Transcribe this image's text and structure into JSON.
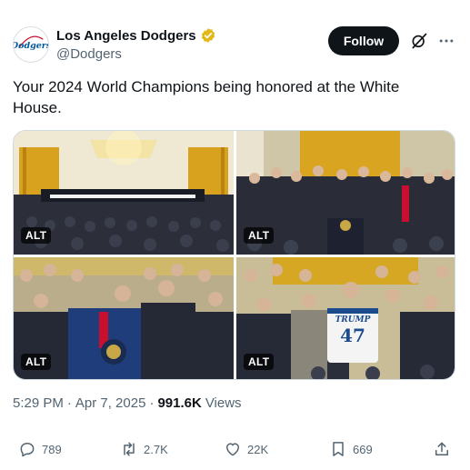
{
  "account": {
    "display_name": "Los Angeles Dodgers",
    "handle": "@Dodgers",
    "avatar_text": "Dodgers",
    "verified_badge_color": "#E2B719"
  },
  "header": {
    "follow_label": "Follow"
  },
  "tweet": {
    "text": "Your 2024 World Champions being honored at the White House."
  },
  "media": {
    "photos": [
      {
        "alt_label": "ALT",
        "description_icon": "east-room-wide-photo"
      },
      {
        "alt_label": "ALT",
        "description_icon": "podium-group-photo"
      },
      {
        "alt_label": "ALT",
        "description_icon": "handshake-photo"
      },
      {
        "alt_label": "ALT",
        "description_icon": "jersey-photo"
      }
    ],
    "jersey_name": "TRUMP",
    "jersey_number": "47"
  },
  "meta": {
    "time": "5:29 PM",
    "separator1": "·",
    "date": "Apr 7, 2025",
    "separator2": "·",
    "views_count": "991.6K",
    "views_label": "Views"
  },
  "actions": {
    "replies": "789",
    "reposts": "2.7K",
    "likes": "22K",
    "bookmarks": "669"
  },
  "colors": {
    "text_primary": "#0f1419",
    "text_secondary": "#536471",
    "dodger_blue": "#005A9C"
  }
}
